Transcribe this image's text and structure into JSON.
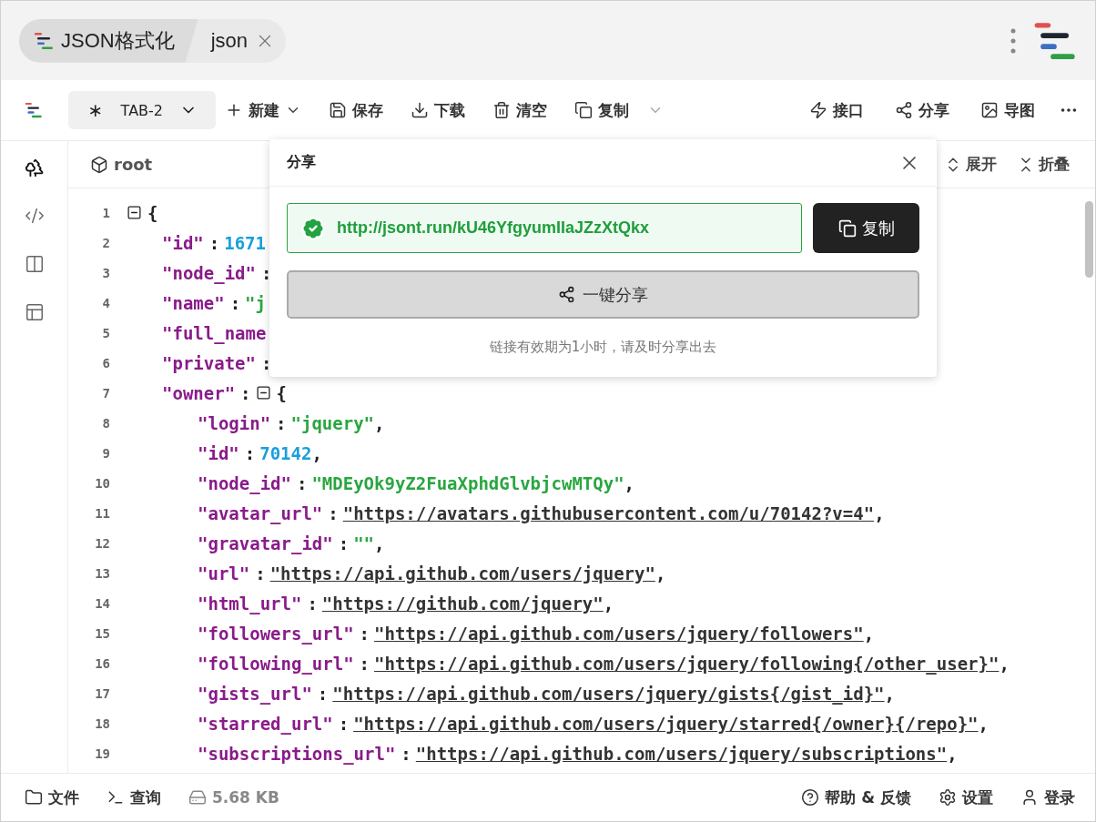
{
  "header": {
    "tabs": [
      {
        "label": "JSON格式化",
        "selected": true
      },
      {
        "label": "json",
        "selected": false
      }
    ]
  },
  "toolbar": {
    "doc_tab": {
      "marker": "∗",
      "label": "TAB-2"
    },
    "actions": [
      {
        "label": "新建"
      },
      {
        "label": "保存"
      },
      {
        "label": "下载"
      },
      {
        "label": "清空"
      },
      {
        "label": "复制"
      }
    ],
    "right_actions": [
      {
        "label": "接口"
      },
      {
        "label": "分享"
      },
      {
        "label": "导图"
      }
    ]
  },
  "sidebar": {
    "items": [
      {
        "selected": true
      },
      {
        "selected": false
      },
      {
        "selected": false
      },
      {
        "selected": false
      }
    ]
  },
  "breadcrumb": {
    "path": "root",
    "actions": [
      {
        "label": "展开"
      },
      {
        "label": "折叠"
      }
    ]
  },
  "editor": {
    "lines": [
      {
        "num": "1",
        "expanded": true,
        "value": "{",
        "kind": "open",
        "children": [
          {
            "num": "2",
            "key": "\"id\"",
            "colon": ":",
            "value": "1671",
            "kind": "number"
          },
          {
            "num": "3",
            "key": "\"node_id\"",
            "colon": ":"
          },
          {
            "num": "4",
            "key": "\"name\"",
            "colon": ":",
            "value": "\"j",
            "kind": "string"
          },
          {
            "num": "5",
            "key": "\"full_name"
          },
          {
            "num": "6",
            "key": "\"private\"",
            "colon": ":"
          },
          {
            "num": "7",
            "key": "\"owner\"",
            "colon": ":",
            "expanded": true,
            "value": "{",
            "kind": "open",
            "children": [
              {
                "num": "8",
                "key": "\"login\"",
                "colon": ":",
                "value": "\"jquery\"",
                "kind": "string",
                "comma": ","
              },
              {
                "num": "9",
                "key": "\"id\"",
                "colon": ":",
                "value": "70142",
                "kind": "number",
                "comma": ","
              },
              {
                "num": "10",
                "key": "\"node_id\"",
                "colon": ":",
                "value": "\"MDEyOk9yZ2FuaXphdGlvbjcwMTQy\"",
                "kind": "string",
                "comma": ","
              },
              {
                "num": "11",
                "key": "\"avatar_url\"",
                "colon": ":",
                "value": "\"https://avatars.githubusercontent.com/u/70142?v=4\"",
                "kind": "url",
                "comma": ","
              },
              {
                "num": "12",
                "key": "\"gravatar_id\"",
                "colon": ":",
                "value": "\"\"",
                "kind": "string",
                "comma": ","
              },
              {
                "num": "13",
                "key": "\"url\"",
                "colon": ":",
                "value": "\"https://api.github.com/users/jquery\"",
                "kind": "url",
                "comma": ","
              },
              {
                "num": "14",
                "key": "\"html_url\"",
                "colon": ":",
                "value": "\"https://github.com/jquery\"",
                "kind": "url",
                "comma": ","
              },
              {
                "num": "15",
                "key": "\"followers_url\"",
                "colon": ":",
                "value": "\"https://api.github.com/users/jquery/followers\"",
                "kind": "url",
                "comma": ","
              },
              {
                "num": "16",
                "key": "\"following_url\"",
                "colon": ":",
                "value": "\"https://api.github.com/users/jquery/following{/other_user}\"",
                "kind": "url",
                "comma": ","
              },
              {
                "num": "17",
                "key": "\"gists_url\"",
                "colon": ":",
                "value": "\"https://api.github.com/users/jquery/gists{/gist_id}\"",
                "kind": "url",
                "comma": ","
              },
              {
                "num": "18",
                "key": "\"starred_url\"",
                "colon": ":",
                "value": "\"https://api.github.com/users/jquery/starred{/owner}{/repo}\"",
                "kind": "url",
                "comma": ","
              },
              {
                "num": "19",
                "key": "\"subscriptions_url\"",
                "colon": ":",
                "value": "\"https://api.github.com/users/jquery/subscriptions\"",
                "kind": "url",
                "comma": ","
              }
            ]
          }
        ]
      }
    ]
  },
  "share_dialog": {
    "title": "分享",
    "link": "http://jsont.run/kU46YfgyumIIaJZzXtQkx",
    "copy_label": "复制",
    "share_label": "一键分享",
    "note": "链接有效期为1小时，请及时分享出去"
  },
  "status_bar": {
    "left": [
      {
        "label": "文件"
      },
      {
        "label": "查询"
      },
      {
        "label": "5.68 KB"
      }
    ],
    "right": [
      {
        "label": "帮助 & 反馈"
      },
      {
        "label": "设置"
      },
      {
        "label": "登录"
      }
    ]
  }
}
